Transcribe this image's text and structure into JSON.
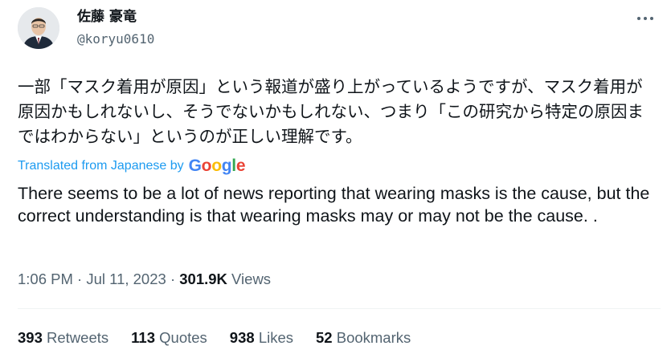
{
  "author": {
    "display_name": "佐藤 豪竜",
    "handle": "@koryu0610",
    "avatar_icon": "person-avatar"
  },
  "tweet": {
    "original_text": "一部「マスク着用が原因」という報道が盛り上がっているようですが、マスク着用が原因かもしれないし、そうでないかもしれない、つまり「この研究から特定の原因まではわからない」というのが正しい理解です。",
    "translation_label": "Translated from Japanese by",
    "translation_provider": "Google",
    "translated_text": "There seems to be a lot of news reporting that wearing masks is the cause, but the correct understanding is that wearing masks may or may not be the cause. ."
  },
  "meta": {
    "time": "1:06 PM",
    "separator": "·",
    "date": "Jul 11, 2023",
    "views_count": "301.9K",
    "views_label": "Views"
  },
  "stats": [
    {
      "count": "393",
      "label": "Retweets"
    },
    {
      "count": "113",
      "label": "Quotes"
    },
    {
      "count": "938",
      "label": "Likes"
    },
    {
      "count": "52",
      "label": "Bookmarks"
    }
  ],
  "colors": {
    "link": "#1d9bf0",
    "secondary_text": "#536471",
    "primary_text": "#0f1419",
    "divider": "#eff3f4"
  },
  "icons": {
    "more": "more-horizontal-icon"
  }
}
